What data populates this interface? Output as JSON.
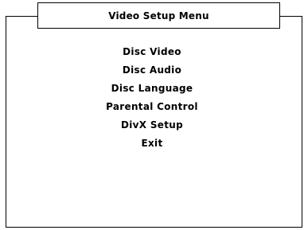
{
  "window": {
    "title": "Video Setup Menu"
  },
  "menu": {
    "items": [
      {
        "label": "Disc Video"
      },
      {
        "label": "Disc Audio"
      },
      {
        "label": "Disc Language"
      },
      {
        "label": "Parental Control"
      },
      {
        "label": "DivX Setup"
      },
      {
        "label": "Exit"
      }
    ]
  }
}
